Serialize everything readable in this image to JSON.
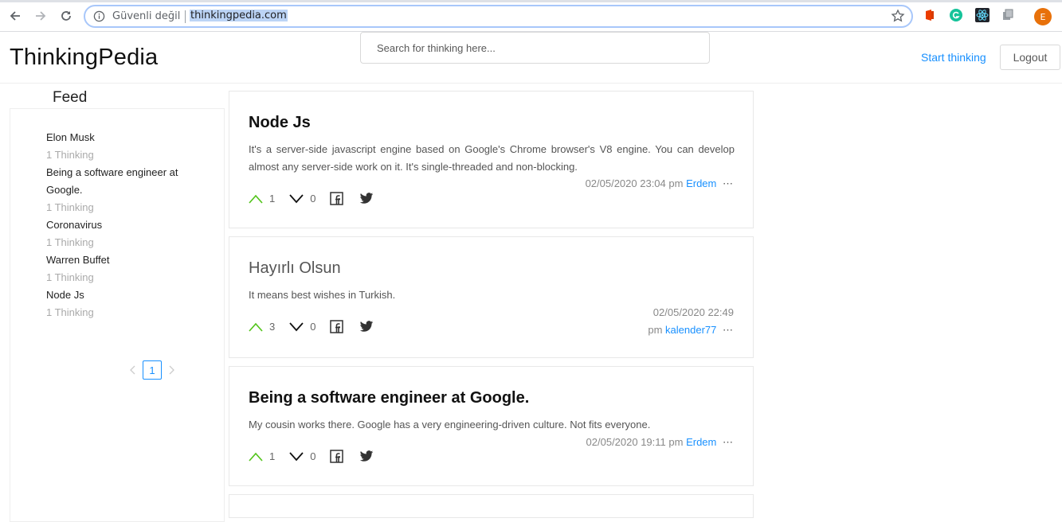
{
  "browser": {
    "insecure_label": "Güvenli değil",
    "url": "thinkingpedia.com",
    "profile_initial": "E"
  },
  "header": {
    "brand": "ThinkingPedia",
    "search_placeholder": "Search for thinking here...",
    "start_link": "Start thinking",
    "logout_label": "Logout"
  },
  "sidebar": {
    "title": "Feed",
    "items": [
      {
        "title": "Elon Musk",
        "count": "1 Thinking"
      },
      {
        "title": "Being a software engineer at Google.",
        "count": "1 Thinking"
      },
      {
        "title": "Coronavirus",
        "count": "1 Thinking"
      },
      {
        "title": "Warren Buffet",
        "count": "1 Thinking"
      },
      {
        "title": "Node Js",
        "count": "1 Thinking"
      }
    ],
    "page": "1"
  },
  "posts": [
    {
      "title": "Node Js",
      "body": "It's a server-side javascript engine based on Google's Chrome browser's V8 engine. You can develop almost any server-side work on it. It's single-threaded and non-blocking.",
      "date": "02/05/2020 23:04 pm",
      "author": "Erdem",
      "up": "1",
      "down": "0"
    },
    {
      "title": "Hayırlı Olsun",
      "body": "It means best wishes in Turkish.",
      "date_line1": "02/05/2020 22:49",
      "date_line2": "pm",
      "author": "kalender77",
      "up": "3",
      "down": "0"
    },
    {
      "title": "Being a software engineer at Google.",
      "body": "My cousin works there. Google has a very engineering-driven culture. Not fits everyone.",
      "date": "02/05/2020 19:11 pm",
      "author": "Erdem",
      "up": "1",
      "down": "0"
    }
  ],
  "colors": {
    "accent": "#1890ff",
    "upvote": "#52c41a",
    "profile": "#e8710a"
  },
  "icons": [
    "back-icon",
    "forward-icon",
    "reload-icon",
    "info-icon",
    "star-icon",
    "upvote-icon",
    "downvote-icon",
    "facebook-icon",
    "twitter-icon"
  ]
}
